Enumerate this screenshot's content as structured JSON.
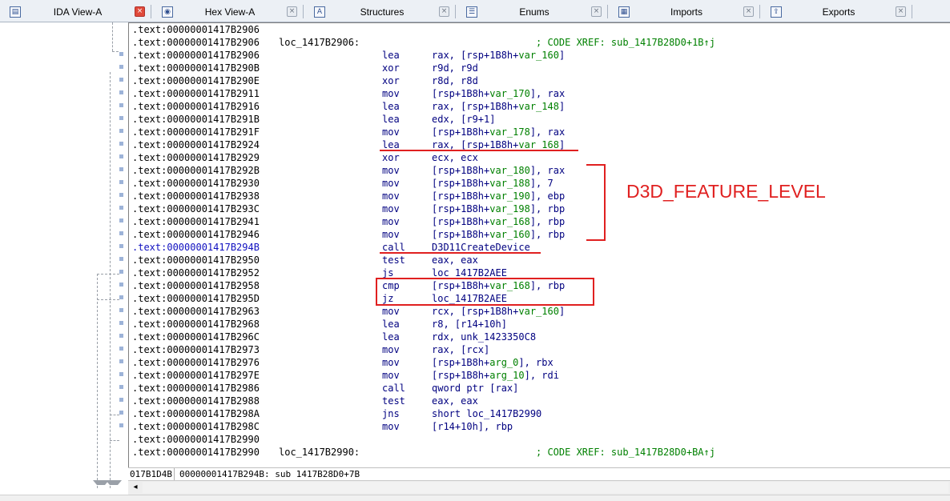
{
  "tabs": [
    {
      "label": "IDA View-A",
      "icon": "ida-view-icon",
      "active": true
    },
    {
      "label": "Hex View-A",
      "icon": "hex-view-icon",
      "active": false
    },
    {
      "label": "Structures",
      "icon": "structures-icon",
      "active": false
    },
    {
      "label": "Enums",
      "icon": "enums-icon",
      "active": false
    },
    {
      "label": "Imports",
      "icon": "imports-icon",
      "active": false
    },
    {
      "label": "Exports",
      "icon": "exports-icon",
      "active": false
    }
  ],
  "tab_close_glyph": "×",
  "lines": [
    {
      "addr": ".text:00000001417B2906",
      "label": "",
      "mnemonic": "",
      "operands": [],
      "comment": ""
    },
    {
      "addr": ".text:00000001417B2906",
      "label": "loc_1417B2906:",
      "mnemonic": "",
      "operands": [],
      "comment": "; CODE XREF: sub_1417B28D0+1B↑j"
    },
    {
      "addr": ".text:00000001417B2906",
      "label": "",
      "mnemonic": "lea",
      "operands": [
        {
          "t": "rax, [rsp+1B8h+",
          "c": "p"
        },
        {
          "t": "var_160",
          "c": "v"
        },
        {
          "t": "]",
          "c": "p"
        }
      ],
      "comment": ""
    },
    {
      "addr": ".text:00000001417B290B",
      "label": "",
      "mnemonic": "xor",
      "operands": [
        {
          "t": "r9d, r9d",
          "c": "p"
        }
      ],
      "comment": ""
    },
    {
      "addr": ".text:00000001417B290E",
      "label": "",
      "mnemonic": "xor",
      "operands": [
        {
          "t": "r8d, r8d",
          "c": "p"
        }
      ],
      "comment": ""
    },
    {
      "addr": ".text:00000001417B2911",
      "label": "",
      "mnemonic": "mov",
      "operands": [
        {
          "t": "[rsp+1B8h+",
          "c": "p"
        },
        {
          "t": "var_170",
          "c": "v"
        },
        {
          "t": "], rax",
          "c": "p"
        }
      ],
      "comment": ""
    },
    {
      "addr": ".text:00000001417B2916",
      "label": "",
      "mnemonic": "lea",
      "operands": [
        {
          "t": "rax, [rsp+1B8h+",
          "c": "p"
        },
        {
          "t": "var_148",
          "c": "v"
        },
        {
          "t": "]",
          "c": "p"
        }
      ],
      "comment": ""
    },
    {
      "addr": ".text:00000001417B291B",
      "label": "",
      "mnemonic": "lea",
      "operands": [
        {
          "t": "edx, [r9+1]",
          "c": "p"
        }
      ],
      "comment": ""
    },
    {
      "addr": ".text:00000001417B291F",
      "label": "",
      "mnemonic": "mov",
      "operands": [
        {
          "t": "[rsp+1B8h+",
          "c": "p"
        },
        {
          "t": "var_178",
          "c": "v"
        },
        {
          "t": "], rax",
          "c": "p"
        }
      ],
      "comment": ""
    },
    {
      "addr": ".text:00000001417B2924",
      "label": "",
      "mnemonic": "lea",
      "operands": [
        {
          "t": "rax, [rsp+1B8h+",
          "c": "p"
        },
        {
          "t": "var_168",
          "c": "v"
        },
        {
          "t": "]",
          "c": "p"
        }
      ],
      "comment": ""
    },
    {
      "addr": ".text:00000001417B2929",
      "label": "",
      "mnemonic": "xor",
      "operands": [
        {
          "t": "ecx, ecx",
          "c": "p"
        }
      ],
      "comment": ""
    },
    {
      "addr": ".text:00000001417B292B",
      "label": "",
      "mnemonic": "mov",
      "operands": [
        {
          "t": "[rsp+1B8h+",
          "c": "p"
        },
        {
          "t": "var_180",
          "c": "v"
        },
        {
          "t": "], rax",
          "c": "p"
        }
      ],
      "comment": ""
    },
    {
      "addr": ".text:00000001417B2930",
      "label": "",
      "mnemonic": "mov",
      "operands": [
        {
          "t": "[rsp+1B8h+",
          "c": "p"
        },
        {
          "t": "var_188",
          "c": "v"
        },
        {
          "t": "], 7",
          "c": "p"
        }
      ],
      "comment": ""
    },
    {
      "addr": ".text:00000001417B2938",
      "label": "",
      "mnemonic": "mov",
      "operands": [
        {
          "t": "[rsp+1B8h+",
          "c": "p"
        },
        {
          "t": "var_190",
          "c": "v"
        },
        {
          "t": "], ebp",
          "c": "p"
        }
      ],
      "comment": ""
    },
    {
      "addr": ".text:00000001417B293C",
      "label": "",
      "mnemonic": "mov",
      "operands": [
        {
          "t": "[rsp+1B8h+",
          "c": "p"
        },
        {
          "t": "var_198",
          "c": "v"
        },
        {
          "t": "], rbp",
          "c": "p"
        }
      ],
      "comment": ""
    },
    {
      "addr": ".text:00000001417B2941",
      "label": "",
      "mnemonic": "mov",
      "operands": [
        {
          "t": "[rsp+1B8h+",
          "c": "p"
        },
        {
          "t": "var_168",
          "c": "v"
        },
        {
          "t": "], rbp",
          "c": "p"
        }
      ],
      "comment": ""
    },
    {
      "addr": ".text:00000001417B2946",
      "label": "",
      "mnemonic": "mov",
      "operands": [
        {
          "t": "[rsp+1B8h+",
          "c": "p"
        },
        {
          "t": "var_160",
          "c": "v"
        },
        {
          "t": "], rbp",
          "c": "p"
        }
      ],
      "comment": ""
    },
    {
      "addr": ".text:00000001417B294B",
      "label": "",
      "mnemonic": "call",
      "operands": [
        {
          "t": "D3D11CreateDevice",
          "c": "n"
        }
      ],
      "comment": "",
      "selected": true
    },
    {
      "addr": ".text:00000001417B2950",
      "label": "",
      "mnemonic": "test",
      "operands": [
        {
          "t": "eax, eax",
          "c": "p"
        }
      ],
      "comment": ""
    },
    {
      "addr": ".text:00000001417B2952",
      "label": "",
      "mnemonic": "js",
      "operands": [
        {
          "t": "loc_1417B2AEE",
          "c": "n"
        }
      ],
      "comment": ""
    },
    {
      "addr": ".text:00000001417B2958",
      "label": "",
      "mnemonic": "cmp",
      "operands": [
        {
          "t": "[rsp+1B8h+",
          "c": "p"
        },
        {
          "t": "var_168",
          "c": "v"
        },
        {
          "t": "], rbp",
          "c": "p"
        }
      ],
      "comment": ""
    },
    {
      "addr": ".text:00000001417B295D",
      "label": "",
      "mnemonic": "jz",
      "operands": [
        {
          "t": "loc_1417B2AEE",
          "c": "n"
        }
      ],
      "comment": ""
    },
    {
      "addr": ".text:00000001417B2963",
      "label": "",
      "mnemonic": "mov",
      "operands": [
        {
          "t": "rcx, [rsp+1B8h+",
          "c": "p"
        },
        {
          "t": "var_160",
          "c": "v"
        },
        {
          "t": "]",
          "c": "p"
        }
      ],
      "comment": ""
    },
    {
      "addr": ".text:00000001417B2968",
      "label": "",
      "mnemonic": "lea",
      "operands": [
        {
          "t": "r8, [r14+10h]",
          "c": "p"
        }
      ],
      "comment": ""
    },
    {
      "addr": ".text:00000001417B296C",
      "label": "",
      "mnemonic": "lea",
      "operands": [
        {
          "t": "rdx, unk_1423350C8",
          "c": "p"
        }
      ],
      "comment": ""
    },
    {
      "addr": ".text:00000001417B2973",
      "label": "",
      "mnemonic": "mov",
      "operands": [
        {
          "t": "rax, [rcx]",
          "c": "p"
        }
      ],
      "comment": ""
    },
    {
      "addr": ".text:00000001417B2976",
      "label": "",
      "mnemonic": "mov",
      "operands": [
        {
          "t": "[rsp+1B8h+",
          "c": "p"
        },
        {
          "t": "arg_0",
          "c": "v"
        },
        {
          "t": "], rbx",
          "c": "p"
        }
      ],
      "comment": ""
    },
    {
      "addr": ".text:00000001417B297E",
      "label": "",
      "mnemonic": "mov",
      "operands": [
        {
          "t": "[rsp+1B8h+",
          "c": "p"
        },
        {
          "t": "arg_10",
          "c": "v"
        },
        {
          "t": "], rdi",
          "c": "p"
        }
      ],
      "comment": ""
    },
    {
      "addr": ".text:00000001417B2986",
      "label": "",
      "mnemonic": "call",
      "operands": [
        {
          "t": "qword ptr [rax]",
          "c": "p"
        }
      ],
      "comment": ""
    },
    {
      "addr": ".text:00000001417B2988",
      "label": "",
      "mnemonic": "test",
      "operands": [
        {
          "t": "eax, eax",
          "c": "p"
        }
      ],
      "comment": ""
    },
    {
      "addr": ".text:00000001417B298A",
      "label": "",
      "mnemonic": "jns",
      "operands": [
        {
          "t": "short loc_1417B2990",
          "c": "n"
        }
      ],
      "comment": ""
    },
    {
      "addr": ".text:00000001417B298C",
      "label": "",
      "mnemonic": "mov",
      "operands": [
        {
          "t": "[r14+10h], rbp",
          "c": "p"
        }
      ],
      "comment": ""
    },
    {
      "addr": ".text:00000001417B2990",
      "label": "",
      "mnemonic": "",
      "operands": [],
      "comment": ""
    },
    {
      "addr": ".text:00000001417B2990",
      "label": "loc_1417B2990:",
      "mnemonic": "",
      "operands": [],
      "comment": "; CODE XREF: sub_1417B28D0+BA↑j"
    }
  ],
  "annotation": {
    "label": "D3D_FEATURE_LEVEL",
    "color": "#e02020"
  },
  "status": {
    "field1": "017B1D4B",
    "field2": "00000001417B294B: sub 1417B28D0+7B"
  },
  "scroll_left_glyph": "◂",
  "colors": {
    "mnemonic": "#000080",
    "variable": "#008000",
    "comment": "#008000",
    "highlight": "#e02020"
  }
}
